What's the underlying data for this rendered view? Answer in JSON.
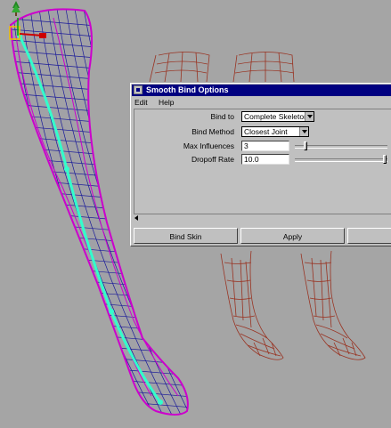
{
  "dialog": {
    "title": "Smooth Bind Options",
    "menu": [
      "Edit",
      "Help"
    ],
    "fields": {
      "bind_to": {
        "label": "Bind to",
        "value": "Complete Skeleton"
      },
      "bind_method": {
        "label": "Bind Method",
        "value": "Closest Joint"
      },
      "max_influences": {
        "label": "Max Influences",
        "value": "3"
      },
      "dropoff_rate": {
        "label": "Dropoff Rate",
        "value": "10.0"
      }
    },
    "buttons": {
      "bind_skin": "Bind Skin",
      "apply": "Apply"
    }
  },
  "sliders": {
    "max_influences_fraction": 0.1,
    "dropoff_rate_fraction": 0.99
  },
  "colors": {
    "viewport_bg": "#a5a5a5",
    "selected_mesh": "#cc00cc",
    "mesh_inner": "#000099",
    "joint_chain": "#33ffcc",
    "ghost_mesh": "#993322",
    "title_bar": "#000080"
  },
  "icons": [
    "camera-icon",
    "pivot-locator-icon",
    "dialog-menu-icon",
    "dropdown-arrow-icon",
    "scroll-left-arrow-icon"
  ]
}
